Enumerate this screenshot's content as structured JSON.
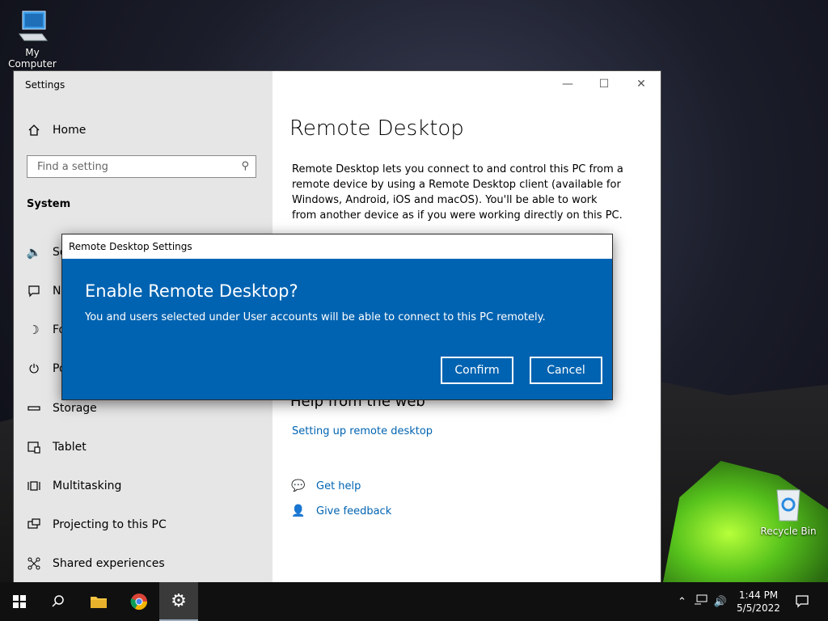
{
  "desktop": {
    "icons": [
      {
        "label": "My Computer",
        "icon": "computer-icon"
      },
      {
        "label": "Recycle Bin",
        "icon": "recycle-bin-icon"
      }
    ]
  },
  "settings": {
    "window_title": "Settings",
    "home_label": "Home",
    "search_placeholder": "Find a setting",
    "section_label": "System",
    "nav_items": [
      {
        "label": "So",
        "icon": "speaker-icon"
      },
      {
        "label": "No",
        "icon": "notification-icon"
      },
      {
        "label": "Fo",
        "icon": "moon-icon"
      },
      {
        "label": "Po",
        "icon": "power-icon"
      },
      {
        "label": "Storage",
        "icon": "storage-icon"
      },
      {
        "label": "Tablet",
        "icon": "tablet-icon"
      },
      {
        "label": "Multitasking",
        "icon": "multitasking-icon"
      },
      {
        "label": "Projecting to this PC",
        "icon": "projecting-icon"
      },
      {
        "label": "Shared experiences",
        "icon": "shared-experiences-icon"
      }
    ],
    "page_title": "Remote Desktop",
    "description": "Remote Desktop lets you connect to and control this PC from a remote device by using a Remote Desktop client (available for Windows, Android, iOS and macOS). You'll be able to work from another device as if you were working directly on this PC.",
    "help_title": "Help from the web",
    "help_link": "Setting up remote desktop",
    "get_help": "Get help",
    "give_feedback": "Give feedback"
  },
  "dialog": {
    "title": "Remote Desktop Settings",
    "heading": "Enable Remote Desktop?",
    "message": "You and users selected under User accounts will be able to connect to this PC remotely.",
    "confirm_label": "Confirm",
    "cancel_label": "Cancel"
  },
  "taskbar": {
    "time": "1:44 PM",
    "date": "5/5/2022"
  },
  "colors": {
    "accent": "#0063b1",
    "link": "#0063b1",
    "sidebar_bg": "#e6e6e6",
    "taskbar_bg": "#101010"
  }
}
